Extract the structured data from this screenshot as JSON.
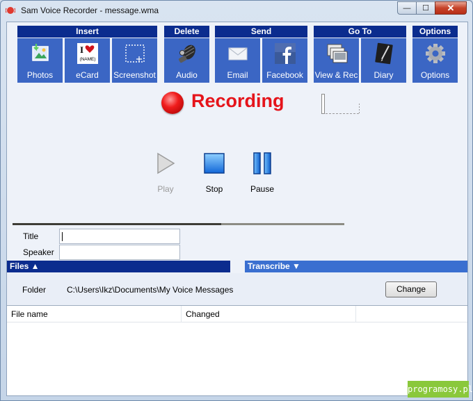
{
  "window": {
    "title": "Sam Voice Recorder - message.wma",
    "controls": {
      "minimize": "—",
      "maximize": "☐",
      "close": "✕"
    }
  },
  "toolbar": {
    "groups": [
      {
        "header": "Insert",
        "tiles": [
          {
            "label": "Photos",
            "icon": "photos-icon"
          },
          {
            "label": "eCard",
            "icon": "ecard-icon",
            "icon_text": "(NAME)"
          },
          {
            "label": "Screenshot",
            "icon": "screenshot-icon"
          }
        ]
      },
      {
        "header": "Delete",
        "tiles": [
          {
            "label": "Audio",
            "icon": "delete-audio-icon"
          }
        ]
      },
      {
        "header": "Send",
        "tiles": [
          {
            "label": "Email",
            "icon": "email-icon"
          },
          {
            "label": "Facebook",
            "icon": "facebook-icon"
          }
        ]
      },
      {
        "header": "Go To",
        "tiles": [
          {
            "label": "View & Rec",
            "icon": "view-rec-icon"
          },
          {
            "label": "Diary",
            "icon": "diary-icon"
          }
        ]
      },
      {
        "header": "Options",
        "tiles": [
          {
            "label": "Options",
            "icon": "gear-icon"
          }
        ]
      }
    ]
  },
  "recording": {
    "status_text": "Recording",
    "color": "#e5141b"
  },
  "transport": {
    "play": "Play",
    "stop": "Stop",
    "pause": "Pause"
  },
  "form": {
    "title_label": "Title",
    "title_value": "",
    "speaker_label": "Speaker",
    "speaker_value": ""
  },
  "files": {
    "header": "Files ▲",
    "folder_label": "Folder",
    "folder_path": "C:\\Users\\Ikz\\Documents\\My Voice Messages",
    "change_button": "Change",
    "columns": [
      "File name",
      "Changed",
      ""
    ]
  },
  "transcribe": {
    "header": "Transcribe ▼"
  },
  "watermark": "programosy.pl",
  "colors": {
    "accent_dark": "#0b2c8e",
    "tile_blue": "#3b66c4",
    "recording_red": "#e5141b"
  }
}
